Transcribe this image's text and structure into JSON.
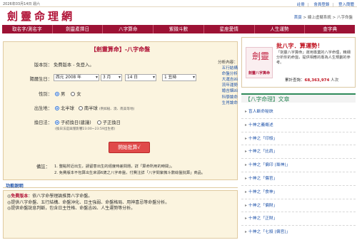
{
  "top": {
    "date": "2026年03月14日 週六",
    "links": [
      "註冊",
      "會員登錄",
      "登入簡體"
    ]
  },
  "logo": {
    "chars": [
      "劍",
      "靈",
      "命",
      "理",
      "網"
    ]
  },
  "breadcrumb": {
    "home": "首頁",
    "path": " > 線上虛擬系統 > 八字命盤"
  },
  "nav": [
    "取名字/測名字",
    "劍靈產擇日",
    "八字算命",
    "紫微斗數",
    "星座愛情",
    "人生運勢",
    "查字典"
  ],
  "form": {
    "title": "【劍靈算命】-八字命盤",
    "version_label": "版本別：",
    "version_value": "免費版本 - 免登入。",
    "date_label": "陽曆生日：",
    "calendar": "西元",
    "year": "2008 年",
    "month": "3 月",
    "day": "14 日",
    "hour": "1 丑時",
    "gender_label": "性別：",
    "gender_options": [
      "男",
      "女"
    ],
    "place_label": "出生地：",
    "place_options": [
      "北半球",
      "南半球"
    ],
    "place_note": "(例如紐、澳、南美等地)",
    "day_change_label": "換日法：",
    "day_change_options": [
      "子初換日(建議)",
      "子正換日"
    ],
    "day_change_note": "(換日法是與僅影響23:00~23:59出生者)",
    "submit": "開始批算√",
    "notes_label": "備註：",
    "notes": [
      "1. 整點附近出生，請留意出生的經度時差問題，詳「算命所用的時間」。",
      "2. 免費版本不包算出生來源6歲之八字命盤，付費注詳「八字問紫微斗數綜盤批算」商品。"
    ]
  },
  "analysis": {
    "head": "分析內容：",
    "items": [
      "五行結構",
      "命盤分析",
      "大運吉凶",
      "流年運勢",
      "婚吉姻凶",
      "科學論命",
      "生肖論命"
    ]
  },
  "explain": {
    "head": "功能說明",
    "lines": [
      {
        "bold": "免費版本",
        "rest": "：依八字命學理論推算八字命盤。"
      },
      {
        "bold": "",
        "rest": "提供八字命盤、五行結構、命盤沖化、日主強弱、命盤格局、用神喜忌等命盤分析。"
      },
      {
        "bold": "",
        "rest": "提供命盤說息判斷，包含日主性格、命盤吉凶、人生運勢等分析。"
      }
    ]
  },
  "ad": {
    "logo_chars": "劍靈",
    "logo_text": "劍靈八字算命",
    "title": "批八字．算運勢！",
    "desc": "「劍靈八字算命」運用專業的八字命理，精細分析你的命盤，提供相應的專為人生規劃的參考。",
    "stat_label": "累計查詢：",
    "stat_value": "68,363,974",
    "stat_unit": "人次"
  },
  "articles": {
    "head": "【八字命理】文章",
    "items": [
      "盲人斷命秘訣",
      "十神之義概述",
      "十神之「印綬」",
      "十神之「比肩」",
      "十神之「偏印 (梟神)」",
      "十神之「傷官」",
      "十神之「食神」",
      "十神之「偏財」",
      "十神之「正財」",
      "十神之「七殺 (偏官)」"
    ]
  },
  "colors": {
    "brand": "#9d1235",
    "accent": "#2f8a5a",
    "link": "#2255aa",
    "panel_bg": "#fbf4df"
  }
}
